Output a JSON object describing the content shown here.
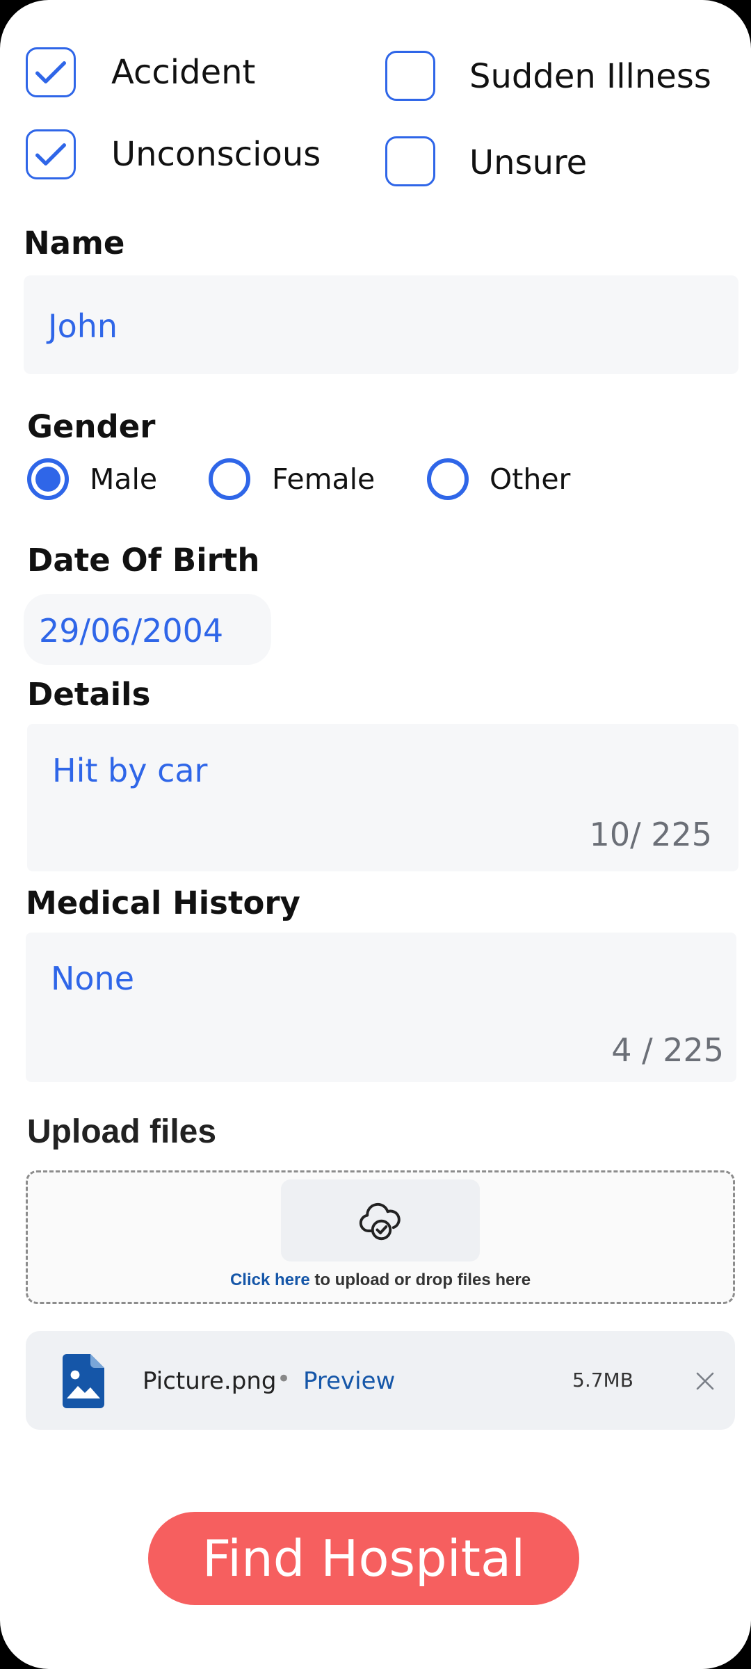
{
  "emergency_types": [
    {
      "label": "Accident",
      "checked": true
    },
    {
      "label": "Unconscious",
      "checked": true
    },
    {
      "label": "Sudden Illness",
      "checked": false
    },
    {
      "label": "Unsure",
      "checked": false
    }
  ],
  "name": {
    "label": "Name",
    "value": "John"
  },
  "gender": {
    "label": "Gender",
    "options": [
      "Male",
      "Female",
      "Other"
    ],
    "selected": "Male"
  },
  "dob": {
    "label": "Date Of Birth",
    "value": "29/06/2004"
  },
  "details": {
    "label": "Details",
    "value": "Hit by car",
    "counter": "10/ 225"
  },
  "medical_history": {
    "label": "Medical History",
    "value": "None",
    "counter": "4 / 225"
  },
  "upload": {
    "label": "Upload files",
    "link_text": "Click here",
    "rest_text": " to upload or drop files here",
    "icon": "cloud-check-icon"
  },
  "file": {
    "name": "Picture.png",
    "separator": "•",
    "preview_label": "Preview",
    "size": "5.7MB",
    "icon": "image-file-icon",
    "remove_icon": "close-icon"
  },
  "cta": {
    "label": "Find Hospital"
  },
  "colors": {
    "accent": "#2f66e8",
    "cta": "#f65f5f",
    "link": "#1556a8"
  }
}
